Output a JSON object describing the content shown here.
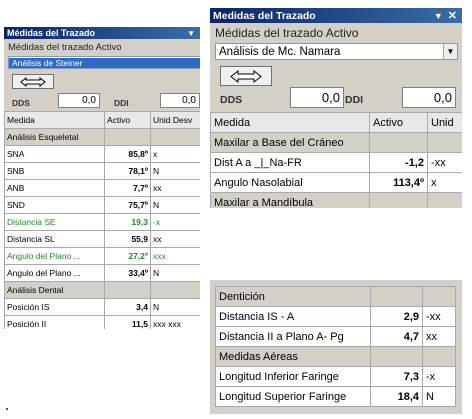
{
  "panel_a": {
    "title": "Médidas del Trazado",
    "subtitle": "Médidas del trazado Activo",
    "combo_value": "Análisis de Steiner",
    "dds_label": "DDS",
    "dds_value": "0,0",
    "ddi_label": "DDI",
    "ddi_value": "0,0",
    "headers": [
      "Medida",
      "Activo",
      "Unid Desv"
    ],
    "rows": [
      {
        "section": "Análisis Esqueletal"
      },
      {
        "name": "SNA",
        "value": "85,8º",
        "unit": "x"
      },
      {
        "name": "SNB",
        "value": "78,1º",
        "unit": "N"
      },
      {
        "name": "ANB",
        "value": "7,7º",
        "unit": "xx"
      },
      {
        "name": "SND",
        "value": "75,7º",
        "unit": "N"
      },
      {
        "name": "Distancia SE",
        "value": "19,3",
        "unit": "-x",
        "color": "green"
      },
      {
        "name": "Distancia SL",
        "value": "55,9",
        "unit": "xx"
      },
      {
        "name": "Angulo del Plano ...",
        "value": "27,2º",
        "unit": "xxx",
        "color": "green"
      },
      {
        "name": "Angulo del Plano ...",
        "value": "33,4º",
        "unit": "N"
      },
      {
        "section": "Análisis Dental"
      },
      {
        "name": "Posición IS",
        "value": "3,4",
        "unit": "N"
      },
      {
        "name": "Posición II",
        "value": "11,5",
        "unit": "xxx xxx"
      }
    ]
  },
  "panel_b": {
    "title": "Medidas del Trazado",
    "subtitle": "Médidas del trazado Activo",
    "combo_value": "Análisis de Mc. Namara",
    "dds_label": "DDS",
    "dds_value": "0,0",
    "ddi_label": "DDI",
    "ddi_value": "0,0",
    "headers": [
      "Medida",
      "Activo",
      "Unid"
    ],
    "rows": [
      {
        "section": "Maxilar a Base del Cráneo"
      },
      {
        "name": "Dist A a _|_Na-FR",
        "value": "-1,2",
        "unit": "-xx"
      },
      {
        "name": "Angulo Nasolabial",
        "value": "113,4º",
        "unit": "x"
      },
      {
        "section": "Maxilar a Mandíbula"
      }
    ]
  },
  "panel_c": {
    "rows": [
      {
        "section": "Dentición"
      },
      {
        "name": "Distancia IS - A",
        "value": "2,9",
        "unit": "-xx"
      },
      {
        "name": "Distancia II a  Plano A- Pg",
        "value": "4,7",
        "unit": "xx"
      },
      {
        "section": "Medidas Aéreas"
      },
      {
        "name": "Longitud Inferior Faringe",
        "value": "7,3",
        "unit": "-x"
      },
      {
        "name": "Longitud Superior Faringe",
        "value": "18,4",
        "unit": "N"
      }
    ]
  },
  "icons": {
    "swap": "double-arrow-icon",
    "dropdown": "chevron-down-icon",
    "pin": "pin-icon",
    "close": "close-icon"
  },
  "colors": {
    "title_bar": "#0a246a",
    "panel_bg": "#d4d0c8",
    "selection": "#316ac5",
    "highlight_text": "#228b22"
  }
}
